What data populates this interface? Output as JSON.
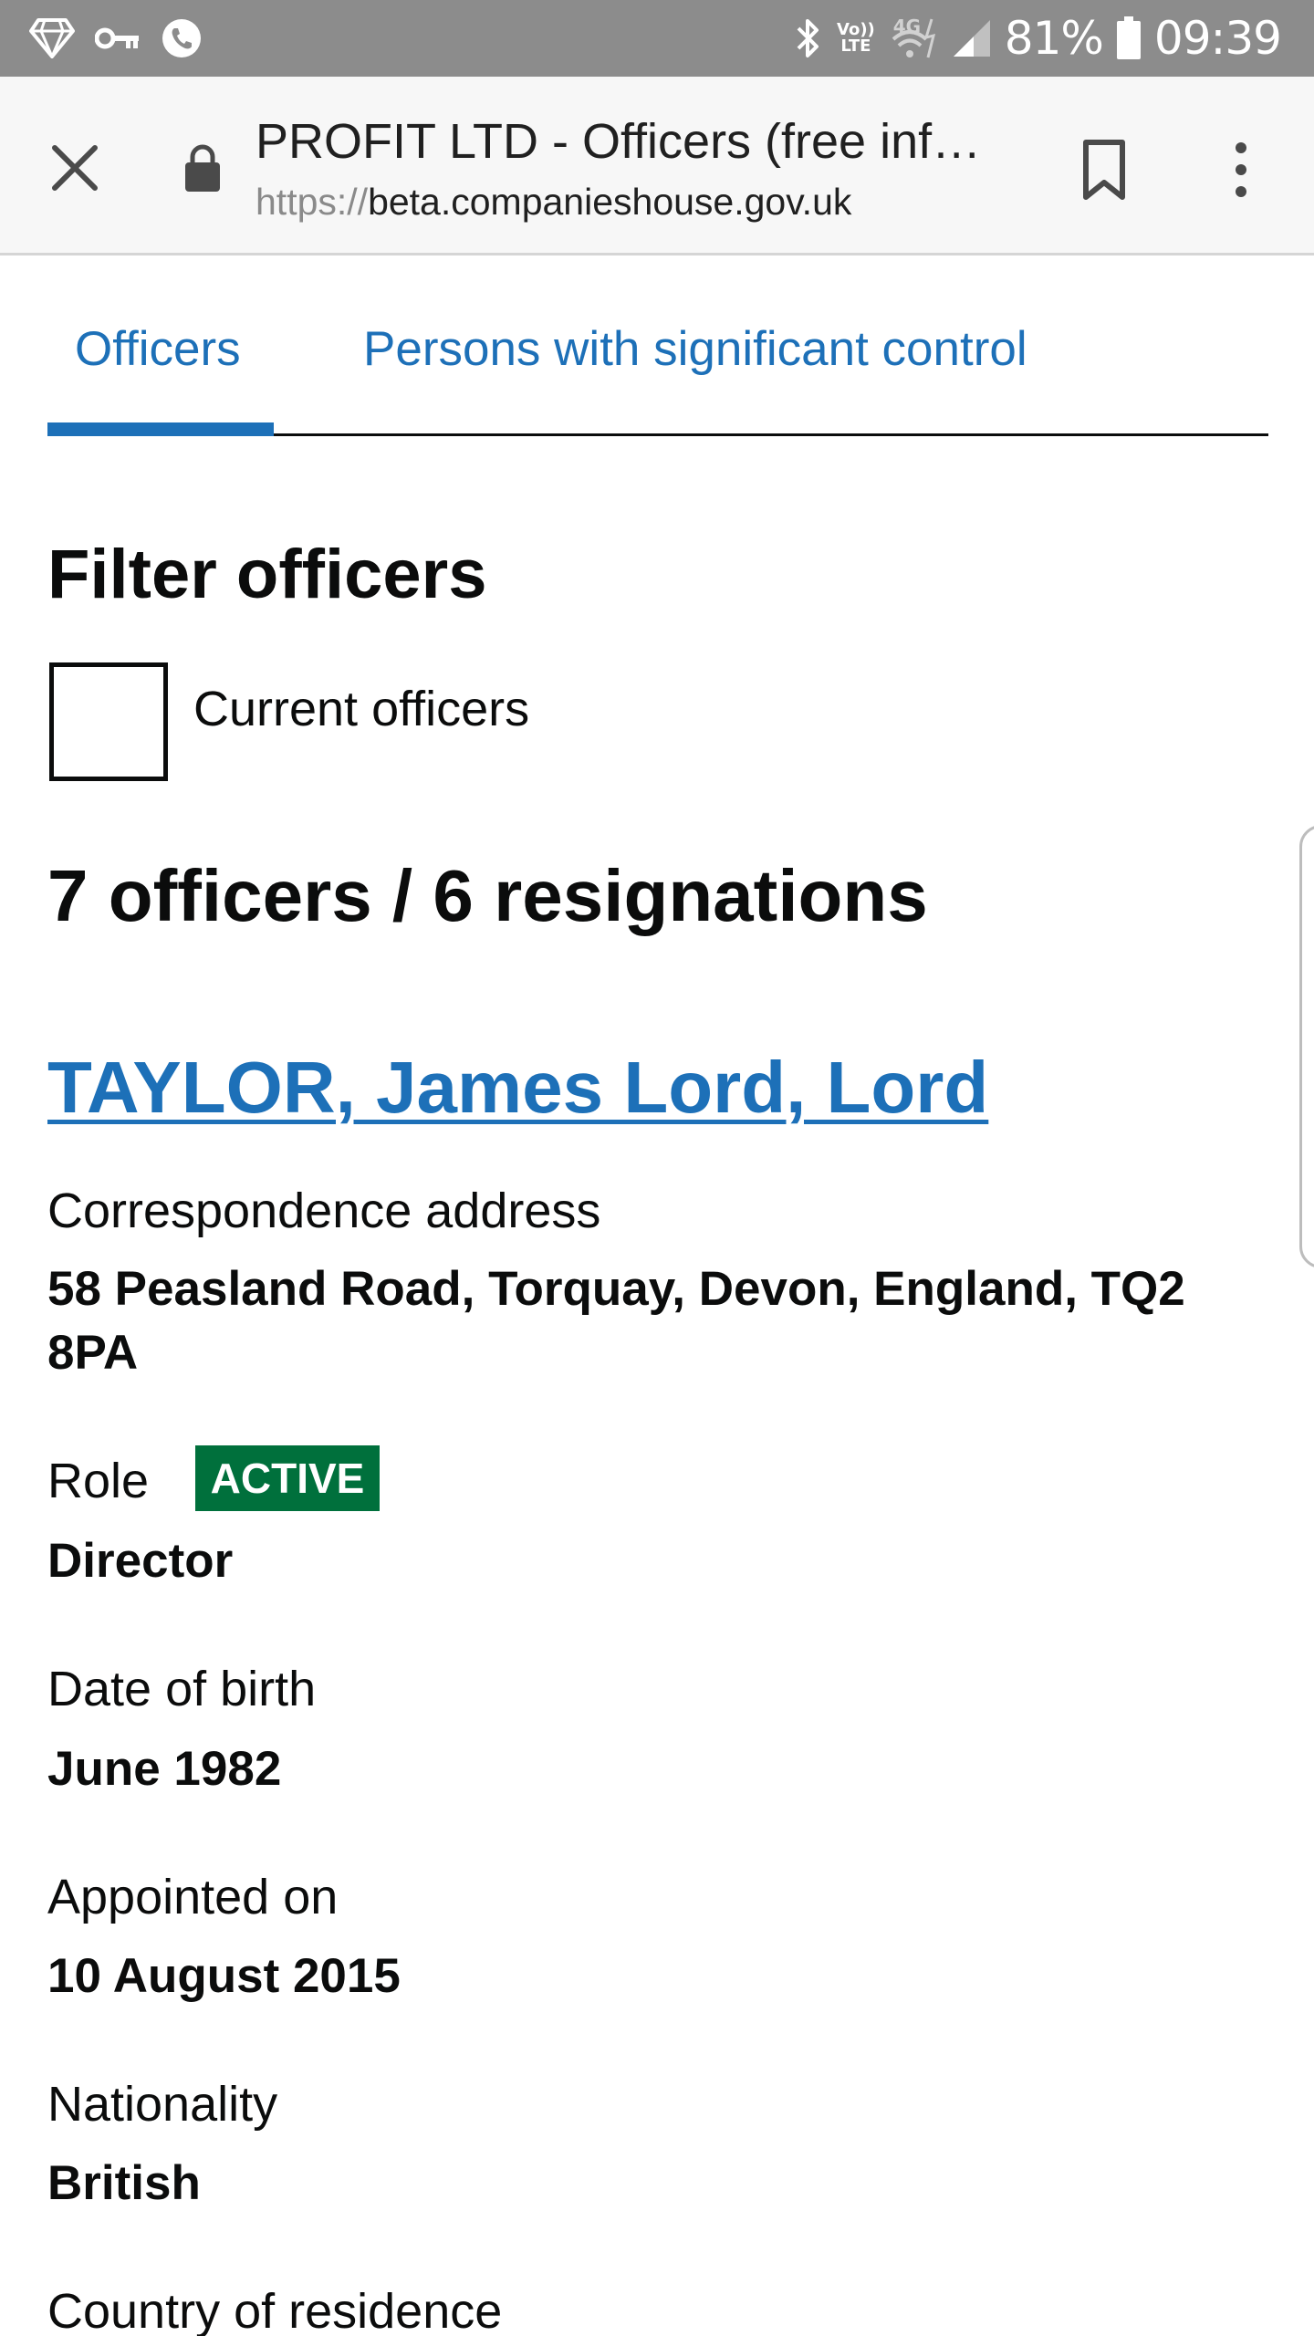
{
  "status_bar": {
    "left_icons": [
      "diamond-icon",
      "key-icon",
      "phone-icon"
    ],
    "right_icons": [
      "bluetooth-icon",
      "volte-icon",
      "wifi-icon",
      "signal-icon",
      "battery-icon"
    ],
    "volte_top": "Vo))",
    "volte_bottom": "LTE",
    "network_type": "4G",
    "battery": "81%",
    "time": "09:39"
  },
  "browser": {
    "title": "PROFIT LTD - Officers (free info…",
    "url_scheme": "https://",
    "url_host": "beta.companieshouse.gov.uk"
  },
  "tabs": [
    {
      "label": "Officers",
      "active": true
    },
    {
      "label": "Persons with significant control",
      "active": false
    }
  ],
  "filter": {
    "heading": "Filter officers",
    "checkbox_label": "Current officers",
    "checked": false
  },
  "summary": "7 officers / 6 resignations",
  "officer": {
    "name": "TAYLOR, James Lord, Lord",
    "address_label": "Correspondence address",
    "address_value": "58 Peasland Road, Torquay, Devon, England, TQ2 8PA",
    "role_label": "Role",
    "role_status": "ACTIVE",
    "role_value": "Director",
    "dob_label": "Date of birth",
    "dob_value": "June 1982",
    "appointed_label": "Appointed on",
    "appointed_value": "10 August 2015",
    "nationality_label": "Nationality",
    "nationality_value": "British",
    "residence_label": "Country of residence"
  },
  "colors": {
    "link_blue": "#1d70b8",
    "active_green": "#00703c",
    "status_bar": "#8c8c8c"
  }
}
